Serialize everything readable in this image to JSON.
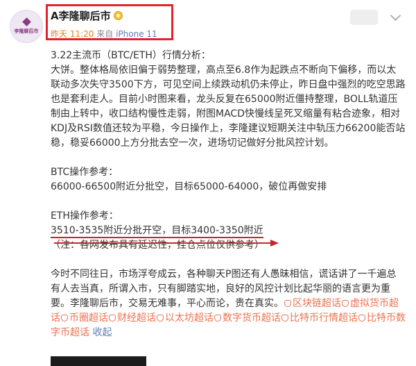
{
  "header": {
    "username": "A李隆聊后市",
    "badge_icon": "gold-crown-badge-icon",
    "avatar_text": "李隆聊后市",
    "time": "昨天 11:20",
    "source_prefix": "来自",
    "device": "iPhone 11"
  },
  "post": {
    "title": "3.22主流币（BTC/ETH）行情分析：",
    "analysis": "大饼。整体格局依旧偏于弱势整理，高点至6.8作为起跌点不断向下偏移，而以太联动多次失守3500下方，可见空间上续跌动机仍未停止，昨日盘中强烈的吃空思路也是套利走人。目前小时图来看，龙头反复在65000附近僵持整理，BOLL轨道压制由上转中，收口结构慢性走弱，附图MACD快慢线呈死叉缩量有粘合迹象，相对KDJ及RSI数值还较为平稳，今日操作上，李隆建议短期关注中轨压力66200能否站稳，稳妥66000上方分批去空一次，进场切记做好分批风控计划。",
    "btc_heading": "BTC操作参考：",
    "btc_line": "66000-66500附近分批空，目标65000-64000，破位再做安排",
    "eth_heading": "ETH操作参考：",
    "eth_line": "3510-3535附近分批开空，目标3400-3350附近",
    "note": "（注：各网发布具有延迟性，挂仓点位仅供参考）",
    "closing": "今时不同往日，市场浮夸成云，各种聊天P图还有人愚昧相信，谎话讲了一千遍总有人去当真，所谓入市，只有脚踏实地，良好的风控计划比起华丽的语言更为重要。李隆聊后市，交易无难事，平心而论，贵在真实。",
    "topics": [
      "区块链超话",
      "虚拟货币超话",
      "币圈超话",
      "财经超话",
      "以太坊超话",
      "数字货币超话",
      "比特币行情超话",
      "比特币数字币超话"
    ],
    "collapse_label": "收起"
  },
  "colors": {
    "highlight_box": "#e4222c",
    "topic": "#eb7350",
    "link": "#5c7db1",
    "time": "#ef7f1a"
  }
}
